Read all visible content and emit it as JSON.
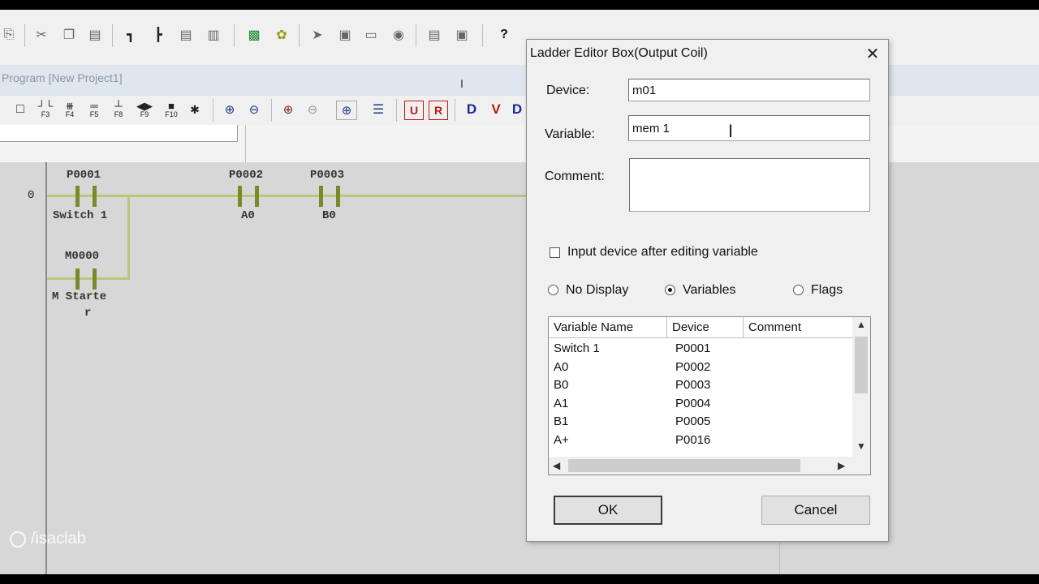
{
  "child_window": {
    "title": "Program [New Project1]"
  },
  "ladder_toolbar": {
    "fkeys": [
      "F3",
      "F4",
      "F5",
      "F8",
      "F9",
      "F10"
    ],
    "letter_buttons": [
      "U",
      "R",
      "D",
      "V",
      "D"
    ]
  },
  "ladder": {
    "rung_number": "0",
    "contacts": [
      {
        "device": "P0001",
        "variable": "Switch 1"
      },
      {
        "device": "P0002",
        "variable": "A0"
      },
      {
        "device": "P0003",
        "variable": "B0"
      },
      {
        "device": "M0000",
        "variable_line1": "M Starte",
        "variable_line2": "r"
      }
    ]
  },
  "watermark": {
    "text": "/isaclab"
  },
  "dialog": {
    "title": "Ladder Editor Box(Output Coil)",
    "close_icon": "close-icon",
    "device_label": "Device:",
    "device_value": "m01",
    "variable_label": "Variable:",
    "variable_value": "mem 1",
    "comment_label": "Comment:",
    "comment_value": "",
    "checkbox_label": "Input device after editing variable",
    "checkbox_checked": false,
    "radio_options": [
      {
        "label": "No Display",
        "selected": false
      },
      {
        "label": "Variables",
        "selected": true
      },
      {
        "label": "Flags",
        "selected": false
      }
    ],
    "list": {
      "headers": [
        "Variable Name",
        "Device",
        "Comment"
      ],
      "rows": [
        {
          "name": "Switch 1",
          "device": "P0001",
          "comment": ""
        },
        {
          "name": "A0",
          "device": "P0002",
          "comment": ""
        },
        {
          "name": "B0",
          "device": "P0003",
          "comment": ""
        },
        {
          "name": "A1",
          "device": "P0004",
          "comment": ""
        },
        {
          "name": "B1",
          "device": "P0005",
          "comment": ""
        },
        {
          "name": "A+",
          "device": "P0016",
          "comment": ""
        }
      ]
    },
    "ok_label": "OK",
    "cancel_label": "Cancel"
  }
}
